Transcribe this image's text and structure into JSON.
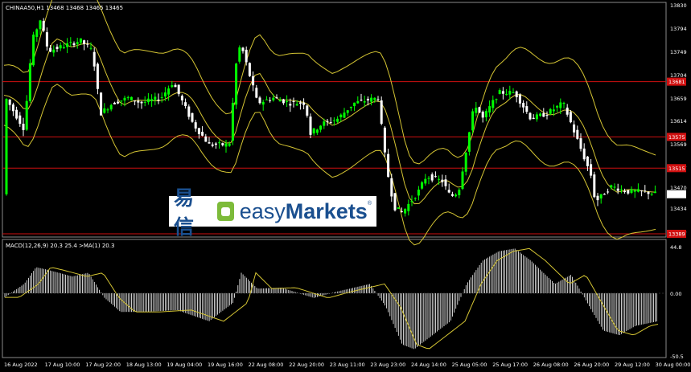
{
  "main_chart": {
    "header_label": "CHINAA50,H1  13468 13468 13465 13465",
    "y_labels": [
      "13830",
      "13794",
      "13749",
      "13704",
      "13659",
      "13614",
      "13569",
      "13524",
      "13470",
      "13434",
      "13389"
    ],
    "price_labels": [
      {
        "text": "13681",
        "price": 13681,
        "color": "#d01010"
      },
      {
        "text": "13575",
        "price": 13575,
        "color": "#d01010"
      },
      {
        "text": "13515",
        "price": 13515,
        "color": "#d01010"
      },
      {
        "text": "13389",
        "price": 13389,
        "color": "#d01010"
      },
      {
        "text": "13465",
        "price": 13465,
        "color": "#ffffff"
      }
    ],
    "current_price": 13465
  },
  "indicator": {
    "header_label": "MACD(12,26,9)  20.3  25.4  >MA(1)  20.3",
    "y_labels": [
      "44.8",
      "0.00",
      "-50.5"
    ]
  },
  "x_labels": [
    "16 Aug 2022",
    "17 Aug 10:00",
    "17 Aug 22:00",
    "18 Aug 13:00",
    "19 Aug 04:00",
    "19 Aug 16:00",
    "22 Aug 08:00",
    "22 Aug 20:00",
    "23 Aug 11:00",
    "23 Aug 23:00",
    "24 Aug 14:00",
    "25 Aug 05:00",
    "25 Aug 17:00",
    "26 Aug 08:00",
    "26 Aug 20:00",
    "29 Aug 12:00",
    "30 Aug 00:00"
  ],
  "logo": {
    "cn": "易信",
    "en_light": "easy",
    "en_bold": "Markets",
    "reg": "®"
  },
  "colors": {
    "background": "#000000",
    "bull_candle": "#00ff00",
    "bear_candle": "#ffffff",
    "bands": "#d4c433",
    "resistance": "#d01010",
    "macd_hist": "#ffffff",
    "signal": "#d4c433",
    "grid": "#1a1a1a"
  }
}
